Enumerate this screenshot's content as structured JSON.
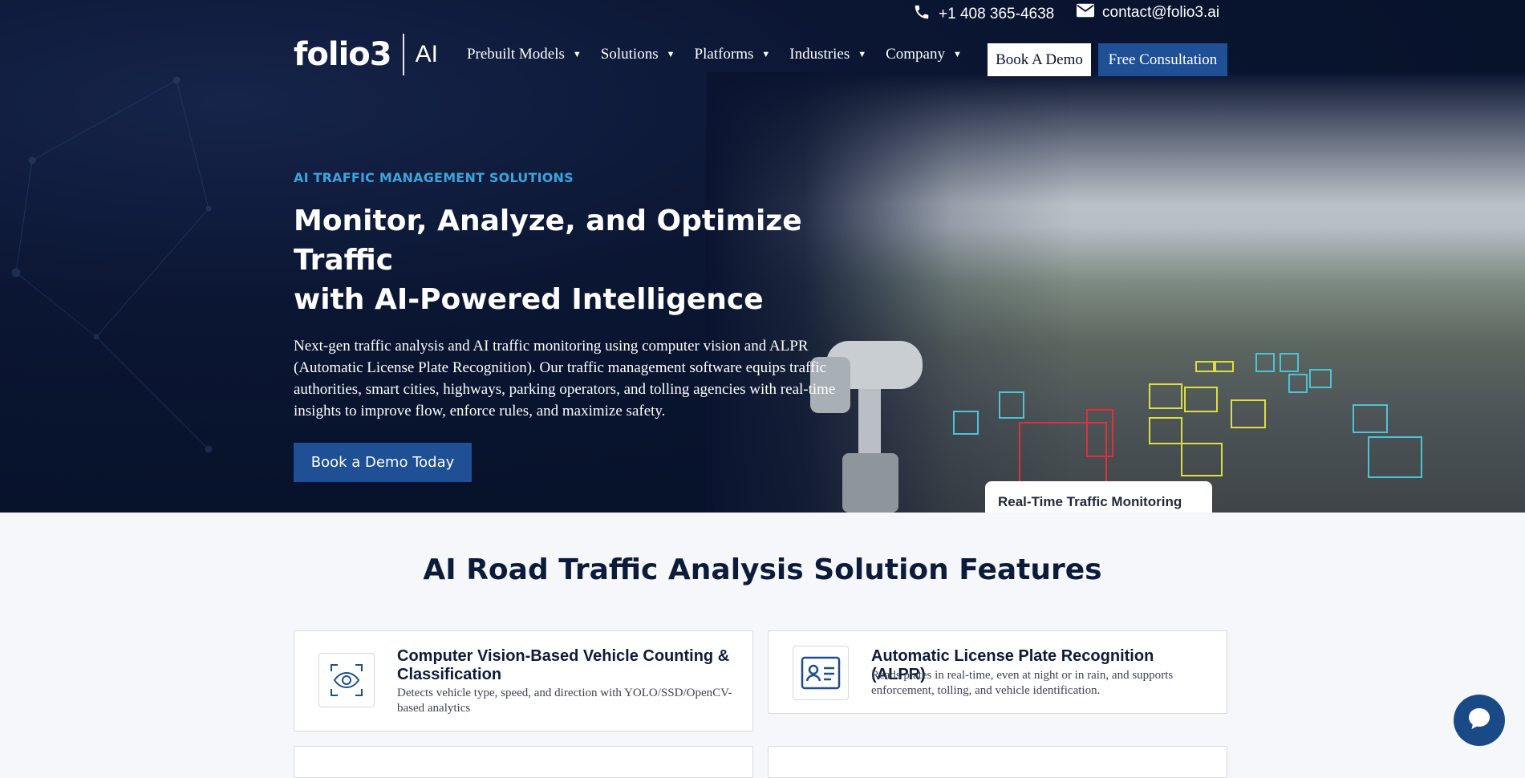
{
  "topbar": {
    "phone": "+1 408 365-4638",
    "email": "contact@folio3.ai"
  },
  "nav": {
    "logo_word": "folio3",
    "logo_ai": "AI",
    "menu": [
      {
        "label": "Prebuilt Models"
      },
      {
        "label": "Solutions"
      },
      {
        "label": "Platforms"
      },
      {
        "label": "Industries"
      },
      {
        "label": "Company"
      }
    ],
    "book_demo": "Book A Demo",
    "free_consultation": "Free Consultation"
  },
  "hero": {
    "eyebrow": "AI TRAFFIC MANAGEMENT SOLUTIONS",
    "headline_line1": "Monitor, Analyze, and Optimize Traffic",
    "headline_line2": "with AI-Powered Intelligence",
    "subtext": "Next-gen traffic analysis and AI traffic monitoring using computer vision and ALPR (Automatic License Plate Recognition). Our traffic management software equips traffic authorities, smart cities, highways, parking operators, and tolling agencies with real-time insights to improve flow, enforce rules, and maximize safety.",
    "cta": "Book a Demo Today",
    "image_tab": "Real-Time Traffic Monitoring"
  },
  "features": {
    "title": "AI Road Traffic Analysis Solution Features",
    "cards": [
      {
        "icon": "eye-scan-icon",
        "title": "Computer Vision-Based Vehicle Counting & Classification",
        "desc": "Detects vehicle type, speed, and direction with YOLO/SSD/OpenCV-based analytics"
      },
      {
        "icon": "id-card-icon",
        "title": "Automatic License Plate Recognition (ALPR)",
        "desc": "Reads plates in real-time, even at night or in rain, and supports enforcement, tolling, and vehicle identification."
      }
    ]
  },
  "colors": {
    "hero_bg": "#07122b",
    "accent_blue": "#1f4f95",
    "eyebrow": "#3ea3dd"
  }
}
